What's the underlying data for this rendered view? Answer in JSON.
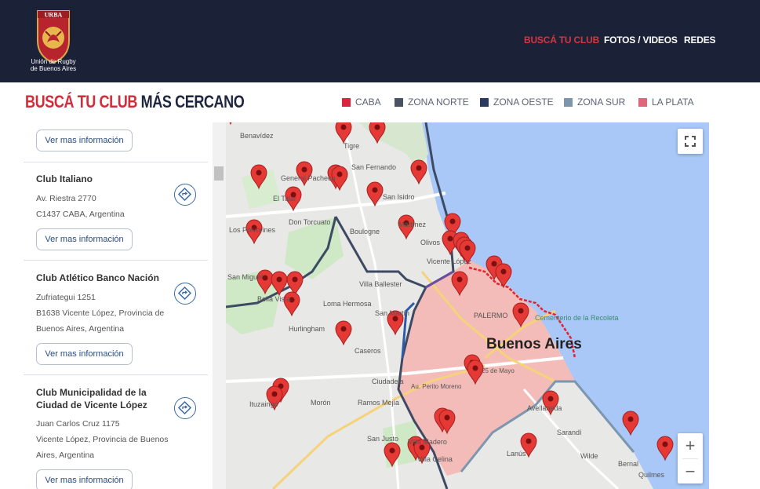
{
  "header": {
    "logo_text": "URBA",
    "logo_caption_1": "Unión de Rugby",
    "logo_caption_2": "de Buenos Aires",
    "nav": [
      {
        "label": "BUSCÁ TU CLUB",
        "active": true
      },
      {
        "label": "FOTOS / VIDEOS",
        "active": false
      },
      {
        "label": "REDES",
        "active": false
      }
    ]
  },
  "page": {
    "title_accent": "BUSCÁ TU CLUB",
    "title_rest": "MÁS CERCANO"
  },
  "legend": [
    {
      "label": "CABA",
      "color": "#d9263d"
    },
    {
      "label": "ZONA NORTE",
      "color": "#4b5266"
    },
    {
      "label": "ZONA OESTE",
      "color": "#2a3a63"
    },
    {
      "label": "ZONA SUR",
      "color": "#7b96ae"
    },
    {
      "label": "LA PLATA",
      "color": "#e0667b"
    }
  ],
  "clubs": {
    "more_label": "Ver mas información",
    "items": [
      {
        "name_1": "Club Italiano",
        "name_2": "",
        "line_1": "Av. Riestra 2770",
        "line_2": "C1437 CABA, Argentina",
        "line_3": ""
      },
      {
        "name_1": "Club Atlético Banco Nación",
        "name_2": "",
        "line_1": "Zufriategui 1251",
        "line_2": "B1638 Vicente López, Provincia de",
        "line_3": "Buenos Aires, Argentina"
      },
      {
        "name_1": "Club Municipalidad de la",
        "name_2": "Ciudad de Vicente López",
        "line_1": "Juan Carlos Cruz 1175",
        "line_2": "Vicente López, Provincia de Buenos",
        "line_3": "Aires, Argentina"
      }
    ]
  },
  "map": {
    "city_label": "Buenos Aires",
    "places": [
      "Benavídez",
      "Tigre",
      "San Fernando",
      "General Pacheco",
      "El Talar",
      "Don Torcuato",
      "San Isidro",
      "Boulogne",
      "Los Polvorines",
      "Martínez",
      "Olivos",
      "Vicente López",
      "Villa Ballester",
      "San Miguel",
      "Bella Vista",
      "Loma Hermosa",
      "San Martín",
      "Hurlingham",
      "Caseros",
      "PALERMO",
      "Cementerio de la Recoleta",
      "Ciudadela",
      "Ituzaingó",
      "Morón",
      "Ramos Mejía",
      "Villa Madero",
      "San Justo",
      "Villa Celina",
      "Avellaneda",
      "Sarandí",
      "Lanús",
      "Wilde",
      "Bernal",
      "Quilmes",
      "25 de Mayo",
      "Au. Perito Moreno"
    ],
    "fullscreen_icon": "fullscreen-icon",
    "zoom_in": "+",
    "zoom_out": "−",
    "colors": {
      "water": "#a9c8f7",
      "land": "#e9e9e6",
      "park": "#cfe8c6",
      "caba_fill": "#f4b7b2",
      "boundary": "#3e4a63",
      "pin": "#e53935"
    }
  }
}
